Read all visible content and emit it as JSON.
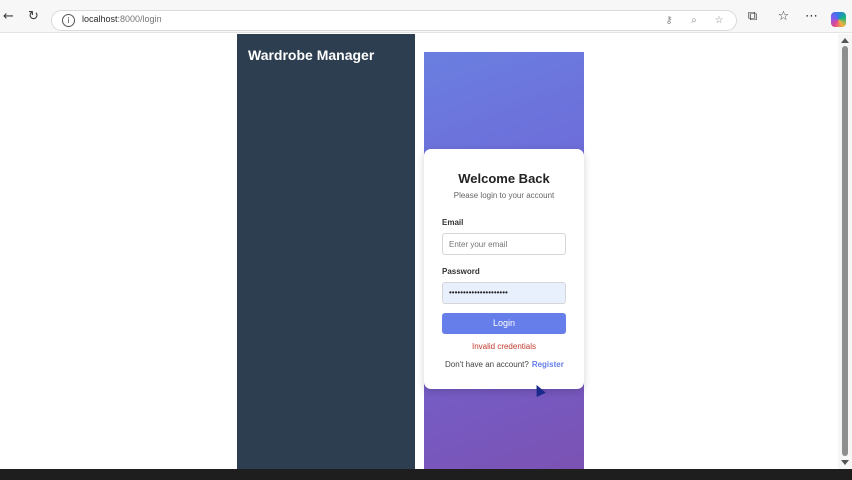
{
  "browser": {
    "url_host": "localhost",
    "url_path": ":8000/login",
    "icons": {
      "back": "arrow-left-icon",
      "reload": "reload-icon",
      "info": "site-info-icon",
      "key": "key-icon",
      "zoom": "zoom-icon",
      "favorite": "star-icon",
      "extensions": "puzzle-icon",
      "favorites": "favorites-list-icon",
      "menu": "more-menu-icon",
      "copilot": "copilot-icon"
    }
  },
  "sidebar": {
    "title": "Wardrobe Manager"
  },
  "login": {
    "title": "Welcome Back",
    "subtitle": "Please login to your account",
    "email_label": "Email",
    "email_placeholder": "Enter your email",
    "email_value": "",
    "password_label": "Password",
    "password_value": "•••••••••••••••••••••",
    "login_button": "Login",
    "error": "Invalid credentials",
    "register_prompt": "Don't have an account?",
    "register_link": "Register"
  },
  "colors": {
    "sidebar_bg": "#2c3e50",
    "accent": "#667eea",
    "gradient_end": "#764ba2",
    "error": "#c0392b"
  }
}
